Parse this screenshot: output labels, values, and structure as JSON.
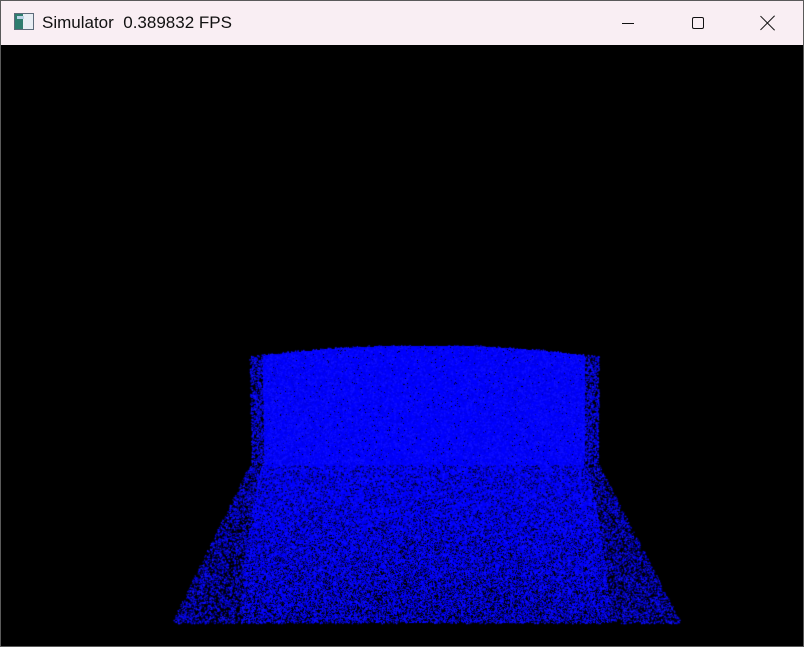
{
  "window": {
    "title": "Simulator  0.389832 FPS",
    "icon": "application-window-icon",
    "controls": {
      "minimize": "minimize-icon",
      "maximize": "maximize-icon",
      "close": "close-icon"
    }
  },
  "simulation": {
    "background_color": "#000000",
    "particle_color": "#0000ff",
    "render": "particle-cloud"
  }
}
